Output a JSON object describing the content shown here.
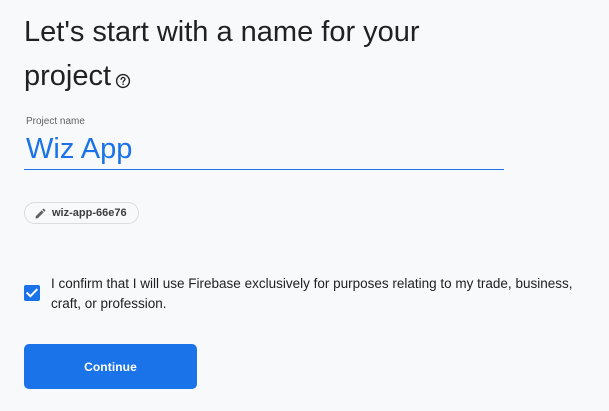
{
  "heading": {
    "title": "Let's start with a name for your project"
  },
  "project_name_field": {
    "label": "Project name",
    "value": "Wiz App"
  },
  "project_id_chip": {
    "text": "wiz-app-66e76",
    "icon": "pencil-icon"
  },
  "confirm": {
    "checked": true,
    "text": "I confirm that I will use Firebase exclusively for purposes relating to my trade, business, craft, or profession."
  },
  "continue_button": {
    "label": "Continue"
  },
  "colors": {
    "accent": "#1a73e8",
    "background": "#f8f9fa",
    "text": "#202124"
  }
}
